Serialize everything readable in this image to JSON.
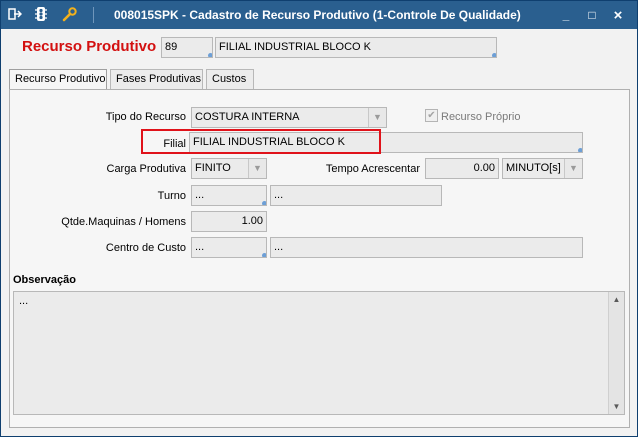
{
  "window": {
    "title": "008015SPK - Cadastro de Recurso Produtivo (1-Controle De Qualidade)",
    "buttons": {
      "minimize": "_",
      "restore": "□",
      "close": "×"
    }
  },
  "toolbar": {
    "icons": [
      "exit-icon",
      "traffic-light-icon",
      "wrench-icon"
    ]
  },
  "header": {
    "label": "Recurso Produtivo",
    "code": "89",
    "name": "FILIAL INDUSTRIAL BLOCO K"
  },
  "tabs": [
    {
      "label": "Recurso Produtivo",
      "active": true
    },
    {
      "label": "Fases Produtivas",
      "active": false
    },
    {
      "label": "Custos",
      "active": false
    }
  ],
  "form": {
    "tipo_label": "Tipo do Recurso",
    "tipo_value": "COSTURA INTERNA",
    "proprio_label": "Recurso Próprio",
    "proprio_checked": true,
    "filial_label": "Filial",
    "filial_value": "FILIAL INDUSTRIAL BLOCO K",
    "carga_label": "Carga Produtiva",
    "carga_value": "FINITO",
    "tempo_label": "Tempo Acrescentar",
    "tempo_value": "0.00",
    "tempo_unit": "MINUTO[s]",
    "turno_label": "Turno",
    "turno_code": "...",
    "turno_desc": "...",
    "qtde_label": "Qtde.Maquinas / Homens",
    "qtde_value": "1.00",
    "centro_label": "Centro de Custo",
    "centro_code": "...",
    "centro_desc": "..."
  },
  "observacao": {
    "label": "Observação",
    "value": "..."
  },
  "colors": {
    "titlebar": "#2a5f8f",
    "accent_red": "#d31010",
    "highlight_border": "#e0121a"
  }
}
